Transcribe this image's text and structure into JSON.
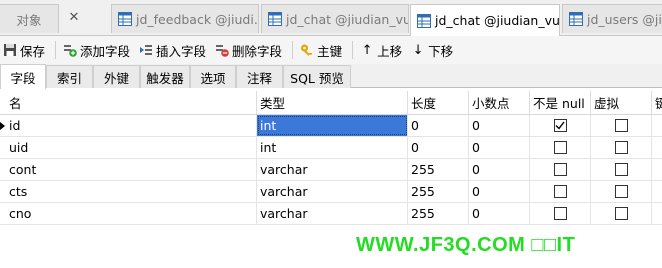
{
  "doc_tabs": [
    {
      "label": "对象"
    },
    {
      "label": "jd_feedback @jiudi..."
    },
    {
      "label": "jd_chat @jiudian_vu..."
    },
    {
      "label": "jd_chat @jiudian_vu..."
    },
    {
      "label": "jd_users @ji"
    }
  ],
  "toolbar": {
    "save": "保存",
    "add_field": "添加字段",
    "insert_field": "插入字段",
    "delete_field": "删除字段",
    "primary_key": "主键",
    "move_up": "上移",
    "move_down": "下移"
  },
  "subtabs": [
    "字段",
    "索引",
    "外键",
    "触发器",
    "选项",
    "注释",
    "SQL 预览"
  ],
  "columns": {
    "name": "名",
    "type": "类型",
    "length": "长度",
    "decimals": "小数点",
    "not_null": "不是 null",
    "virtual": "虚拟",
    "more": "键"
  },
  "rows": [
    {
      "name": "id",
      "type": "int",
      "length": "0",
      "decimals": "0",
      "not_null": true,
      "virtual": false
    },
    {
      "name": "uid",
      "type": "int",
      "length": "0",
      "decimals": "0",
      "not_null": false,
      "virtual": false
    },
    {
      "name": "cont",
      "type": "varchar",
      "length": "255",
      "decimals": "0",
      "not_null": false,
      "virtual": false
    },
    {
      "name": "cts",
      "type": "varchar",
      "length": "255",
      "decimals": "0",
      "not_null": false,
      "virtual": false
    },
    {
      "name": "cno",
      "type": "varchar",
      "length": "255",
      "decimals": "0",
      "not_null": false,
      "virtual": false
    }
  ],
  "watermark": "WWW.JF3Q.COM □□IT",
  "colors": {
    "selection": "#3c78d8",
    "watermark": "#22dd22",
    "table_icon": "#2f6db5"
  },
  "icons": {
    "table": "table-icon",
    "save": "save-icon",
    "add": "add-field-icon",
    "insert": "insert-field-icon",
    "delete": "delete-field-icon",
    "key": "key-icon",
    "up": "arrow-up-icon",
    "down": "arrow-down-icon"
  }
}
